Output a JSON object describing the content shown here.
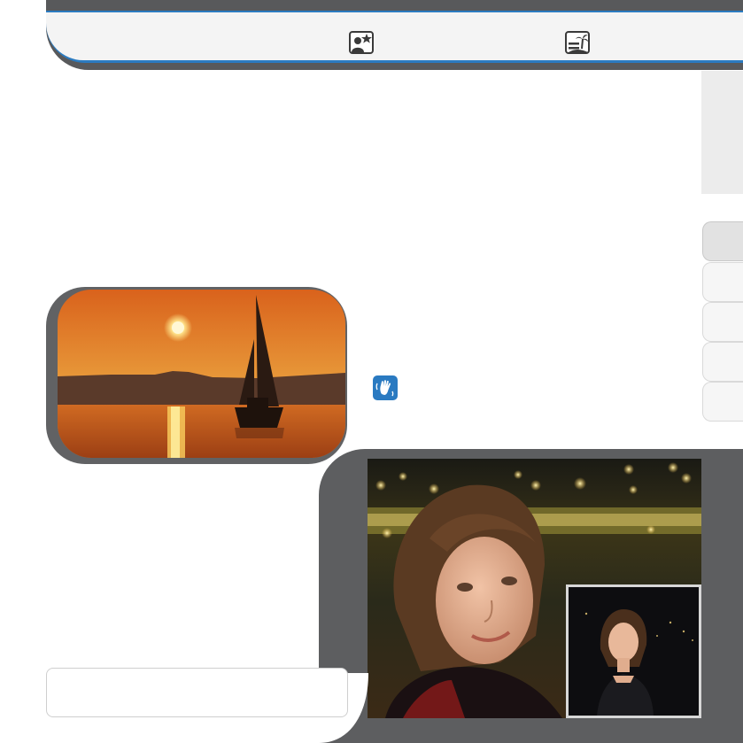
{
  "header": {
    "icons": [
      "portrait-star-icon",
      "landscape-palm-icon"
    ]
  },
  "side_tabs": {
    "count": 5,
    "active_index": 0
  },
  "photos": {
    "sunset": "sailboat-at-sunset",
    "portrait": "woman-night-portrait",
    "inset": "woman-night-portrait-thumbnail"
  },
  "note_icon": "hand-wave-icon",
  "caption": {
    "text": ""
  },
  "colors": {
    "header_dark": "#58595b",
    "header_accent": "#2b7bc0",
    "icon_blue": "#2a7ac1",
    "frame_gray": "#5d5e60"
  }
}
